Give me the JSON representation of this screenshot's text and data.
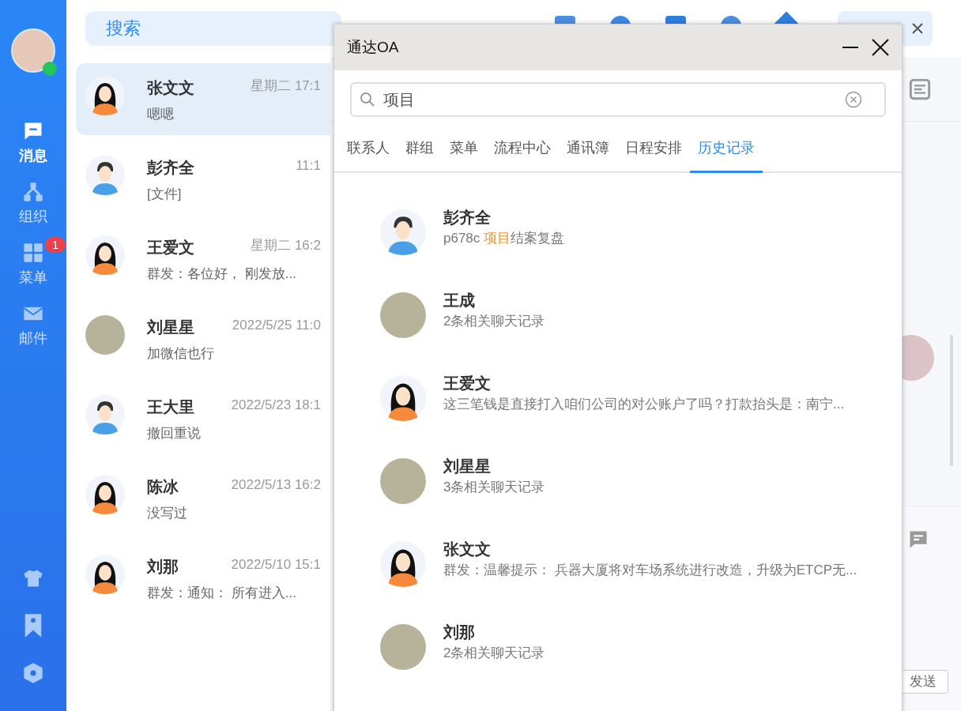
{
  "sidebar": {
    "nav": [
      {
        "label": "消息",
        "selected": true,
        "kind": "message"
      },
      {
        "label": "组织",
        "selected": false,
        "kind": "org"
      },
      {
        "label": "菜单",
        "selected": false,
        "kind": "menu",
        "badge": "1"
      },
      {
        "label": "邮件",
        "selected": false,
        "kind": "mail"
      }
    ]
  },
  "top_bar": {
    "search_placeholder": "搜索"
  },
  "chats": [
    {
      "name": "张文文",
      "time": "星期二 17:1",
      "preview": "嗯嗯",
      "kind": "female",
      "selected": true
    },
    {
      "name": "彭齐全",
      "time": "11:1",
      "preview": "[文件]",
      "kind": "male",
      "selected": false
    },
    {
      "name": "王爱文",
      "time": "星期二 16:2",
      "preview": "群发：各位好， 刚发放...",
      "kind": "female",
      "selected": false
    },
    {
      "name": "刘星星",
      "time": "2022/5/25 11:0",
      "preview": "加微信也行",
      "kind": "photo",
      "selected": false
    },
    {
      "name": "王大里",
      "time": "2022/5/23 18:1",
      "preview": "撤回重说",
      "kind": "male",
      "selected": false
    },
    {
      "name": "陈冰",
      "time": "2022/5/13 16:2",
      "preview": "没写过",
      "kind": "female",
      "selected": false
    },
    {
      "name": "刘那",
      "time": "2022/5/10 15:1",
      "preview": "群发：通知： 所有进入...",
      "kind": "female",
      "selected": false
    }
  ],
  "chat_pane": {
    "send_button": "发送"
  },
  "dialog": {
    "title": "通达OA",
    "search": {
      "value": "项目"
    },
    "tabs": [
      {
        "label": "联系人",
        "selected": false
      },
      {
        "label": "群组",
        "selected": false
      },
      {
        "label": "菜单",
        "selected": false
      },
      {
        "label": "流程中心",
        "selected": false
      },
      {
        "label": "通讯簿",
        "selected": false
      },
      {
        "label": "日程安排",
        "selected": false
      },
      {
        "label": "历史记录",
        "selected": true
      }
    ],
    "results": [
      {
        "name": "彭齐全",
        "kind": "male",
        "snippet": [
          "p678c ",
          "项目",
          "结案复盘"
        ]
      },
      {
        "name": "王成",
        "kind": "photo",
        "snippet": [
          "2条相关聊天记录"
        ]
      },
      {
        "name": "王爱文",
        "kind": "female",
        "snippet": [
          "这三笔钱是直接打入咱们公司的对公账户了吗？打款抬头是：南宁..."
        ]
      },
      {
        "name": "刘星星",
        "kind": "photo",
        "snippet": [
          "3条相关聊天记录"
        ]
      },
      {
        "name": "张文文",
        "kind": "female",
        "snippet": [
          "群发：温馨提示： 兵器大厦将对车场系统进行改造，升级为ETCP无..."
        ]
      },
      {
        "name": "刘那",
        "kind": "photo",
        "snippet": [
          "2条相关聊天记录"
        ]
      }
    ]
  }
}
